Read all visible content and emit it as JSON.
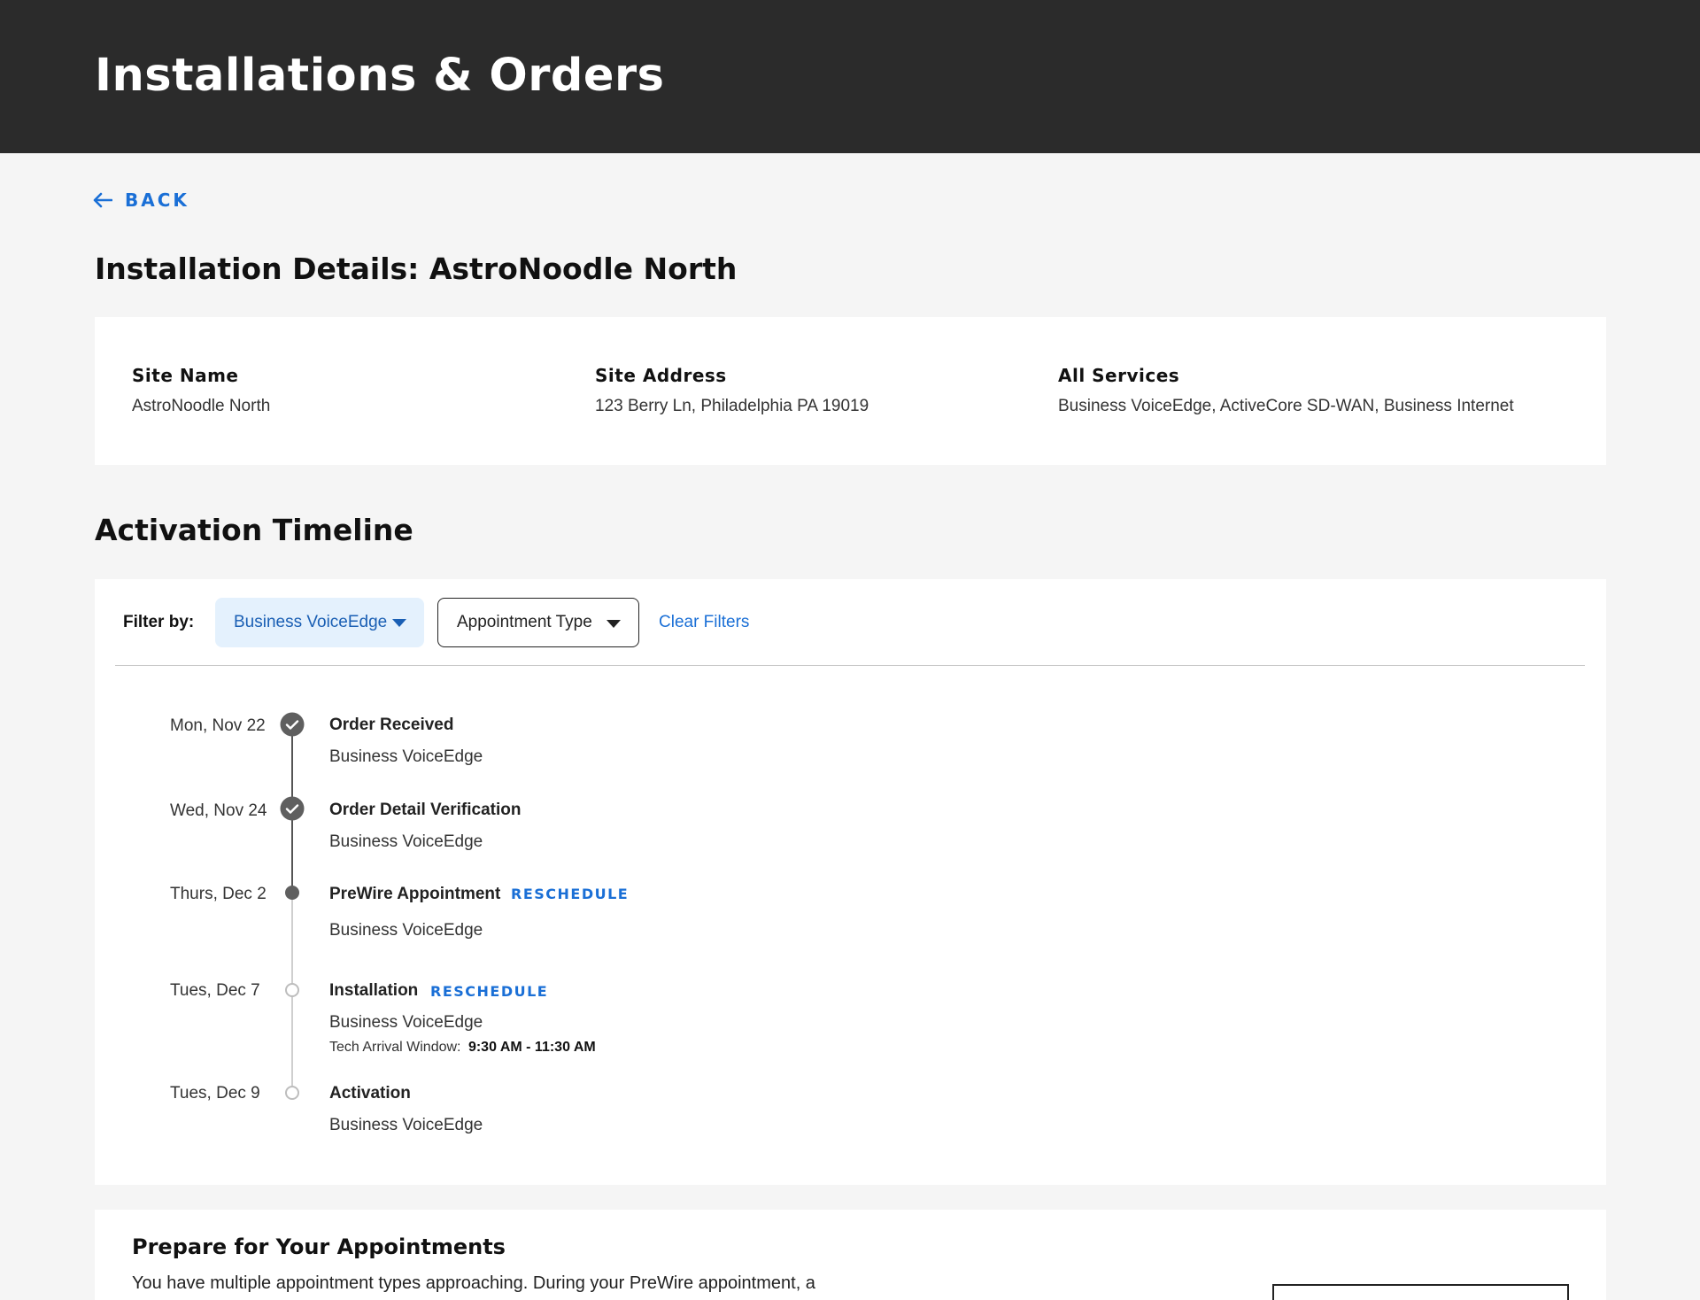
{
  "header": {
    "title": "Installations & Orders"
  },
  "back": {
    "label": "BACK"
  },
  "page": {
    "title": "Installation Details: AstroNoodle North"
  },
  "site": {
    "name_label": "Site Name",
    "name_value": "AstroNoodle North",
    "address_label": "Site Address",
    "address_value": "123 Berry Ln, Philadelphia PA 19019",
    "services_label": "All Services",
    "services_value": "Business VoiceEdge, ActiveCore SD-WAN, Business Internet"
  },
  "timeline": {
    "title": "Activation Timeline",
    "filter_label": "Filter by:",
    "filter_service": "Business VoiceEdge",
    "filter_appointment": "Appointment Type",
    "clear_filters": "Clear Filters",
    "reschedule_label": "RESCHEDULE",
    "tech_window_label": "Tech Arrival Window:",
    "tech_window_value": "9:30 AM - 11:30 AM",
    "steps": [
      {
        "date": "Mon, Nov 22",
        "title": "Order Received",
        "service": "Business VoiceEdge",
        "status": "completed"
      },
      {
        "date": "Wed, Nov 24",
        "title": "Order Detail Verification",
        "service": "Business VoiceEdge",
        "status": "completed"
      },
      {
        "date": "Thurs, Dec 2",
        "title": "PreWire Appointment",
        "service": "Business VoiceEdge",
        "status": "current"
      },
      {
        "date": "Tues, Dec 7",
        "title": "Installation",
        "service": "Business VoiceEdge",
        "status": "upcoming"
      },
      {
        "date": "Tues, Dec 9",
        "title": "Activation",
        "service": "Business VoiceEdge",
        "status": "upcoming"
      }
    ]
  },
  "prepare": {
    "title": "Prepare for Your Appointments",
    "text": "You have multiple appointment types approaching.  During your PreWire appointment, a"
  },
  "colors": {
    "header_bg": "#2b2b2b",
    "accent": "#1a6fd6",
    "filter_active_bg": "#e4f1fd"
  },
  "icons": {
    "back": "arrow-left-icon",
    "completed": "check-circle-icon",
    "dropdown": "caret-down-icon"
  }
}
